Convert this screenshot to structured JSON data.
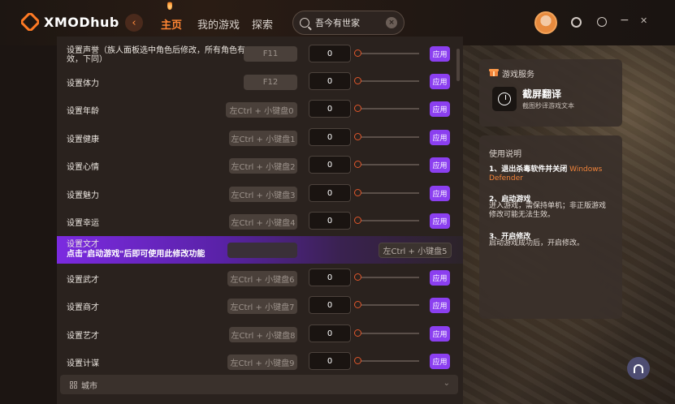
{
  "app": {
    "logo_text": "XMODhub"
  },
  "nav": {
    "home": "主页",
    "my_games": "我的游戏",
    "explore": "探索"
  },
  "search": {
    "value": "吾今有世家"
  },
  "window": {
    "minimize": "−",
    "close": "✕"
  },
  "rows": [
    {
      "label": "设置声誉（族人面板选中角色后修改，所有角色有效，下同）",
      "hotkey": "F11",
      "value": "0",
      "apply": "应用"
    },
    {
      "label": "设置体力",
      "hotkey": "F12",
      "value": "0",
      "apply": "应用"
    },
    {
      "label": "设置年龄",
      "hotkey": "左Ctrl + 小键盘0",
      "value": "0",
      "apply": "应用"
    },
    {
      "label": "设置健康",
      "hotkey": "左Ctrl + 小键盘1",
      "value": "0",
      "apply": "应用"
    },
    {
      "label": "设置心情",
      "hotkey": "左Ctrl + 小键盘2",
      "value": "0",
      "apply": "应用"
    },
    {
      "label": "设置魅力",
      "hotkey": "左Ctrl + 小键盘3",
      "value": "0",
      "apply": "应用"
    },
    {
      "label": "设置幸运",
      "hotkey": "左Ctrl + 小键盘4",
      "value": "0",
      "apply": "应用"
    }
  ],
  "locked_row": {
    "label": "设置文才",
    "warning": "点击\"启动游戏\"后即可使用此修改功能",
    "hotkey": "左Ctrl + 小键盘5"
  },
  "rows2": [
    {
      "label": "设置武才",
      "hotkey": "左Ctrl + 小键盘6",
      "value": "0",
      "apply": "应用"
    },
    {
      "label": "设置商才",
      "hotkey": "左Ctrl + 小键盘7",
      "value": "0",
      "apply": "应用"
    },
    {
      "label": "设置艺才",
      "hotkey": "左Ctrl + 小键盘8",
      "value": "0",
      "apply": "应用"
    },
    {
      "label": "设置计谋",
      "hotkey": "左Ctrl + 小键盘9",
      "value": "0",
      "apply": "应用"
    }
  ],
  "section": {
    "label": "城市"
  },
  "services": {
    "title": "游戏服务",
    "item_title": "截屏翻译",
    "item_sub": "截图秒译游戏文本"
  },
  "help": {
    "title": "使用说明",
    "step1_head": "1、退出杀毒软件并关闭",
    "step1_highlight": "Windows Defender",
    "step2_head": "2、启动游戏",
    "step2_body": "进入游戏，需保持单机；非正版游戏修改可能无法生效。",
    "step3_head": "3、开启修改",
    "step3_body": "启动游戏成功后，开启修改。"
  },
  "colors": {
    "accent": "#ff8533",
    "apply": "#8b3ff0",
    "locked": "#7b2ae0"
  }
}
